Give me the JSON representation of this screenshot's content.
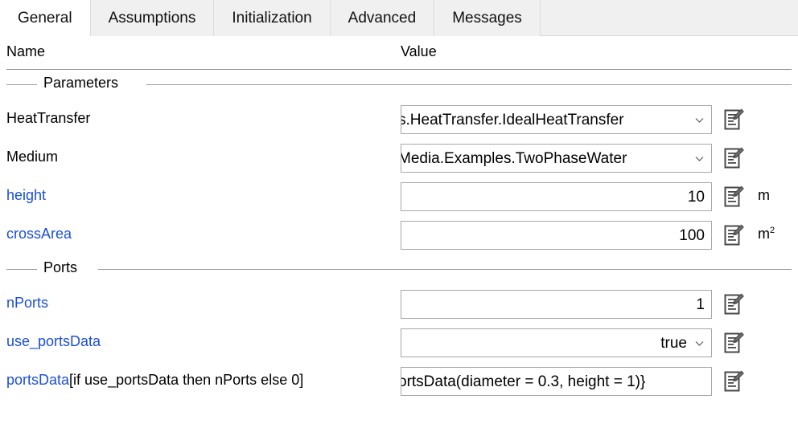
{
  "tabs": [
    {
      "label": "General",
      "active": true
    },
    {
      "label": "Assumptions",
      "active": false
    },
    {
      "label": "Initialization",
      "active": false
    },
    {
      "label": "Advanced",
      "active": false
    },
    {
      "label": "Messages",
      "active": false
    }
  ],
  "columns": {
    "name": "Name",
    "value": "Value"
  },
  "groups": [
    {
      "title": "Parameters",
      "rows": [
        {
          "name": "HeatTransfer",
          "name_suffix": "",
          "name_color": "#000000",
          "value": "s.HeatTransfer.IdealHeatTransfer",
          "value_align": "clipleft",
          "has_dropdown": true,
          "has_edit_icon": true,
          "unit": "",
          "unit_sup": ""
        },
        {
          "name": "Medium",
          "name_suffix": "",
          "name_color": "#000000",
          "value": "Media.Examples.TwoPhaseWater",
          "value_align": "clipleft",
          "has_dropdown": true,
          "has_edit_icon": true,
          "unit": "",
          "unit_sup": ""
        },
        {
          "name": "height",
          "name_suffix": "",
          "name_color": "#1a4fd6",
          "value": "10",
          "value_align": "right",
          "has_dropdown": false,
          "has_edit_icon": true,
          "unit": "m",
          "unit_sup": ""
        },
        {
          "name": "crossArea",
          "name_suffix": "",
          "name_color": "#1a4fd6",
          "value": "100",
          "value_align": "right",
          "has_dropdown": false,
          "has_edit_icon": true,
          "unit": "m",
          "unit_sup": "2"
        }
      ]
    },
    {
      "title": "Ports",
      "rows": [
        {
          "name": "nPorts",
          "name_suffix": "",
          "name_color": "#1a4fd6",
          "value": "1",
          "value_align": "right",
          "has_dropdown": false,
          "has_edit_icon": true,
          "unit": "",
          "unit_sup": ""
        },
        {
          "name": "use_portsData",
          "name_suffix": "",
          "name_color": "#1a4fd6",
          "value": "true",
          "value_align": "right-drop",
          "has_dropdown": true,
          "has_edit_icon": true,
          "unit": "",
          "unit_sup": ""
        },
        {
          "name": "portsData",
          "name_suffix": "[if use_portsData then nPorts else 0]",
          "name_color": "#1a4fd6",
          "value": "ortsData(diameter = 0.3, height = 1)}",
          "value_align": "clipleft",
          "has_dropdown": false,
          "has_edit_icon": true,
          "unit": "",
          "unit_sup": ""
        }
      ]
    }
  ],
  "icons": {
    "edit": "edit-document-icon",
    "dropdown": "chevron-down-icon"
  },
  "colors": {
    "link": "#1a4fd6",
    "tabstrip_bg": "#f0f0f0",
    "rule": "#9a9a9a",
    "field_border": "#a7a7a7"
  }
}
